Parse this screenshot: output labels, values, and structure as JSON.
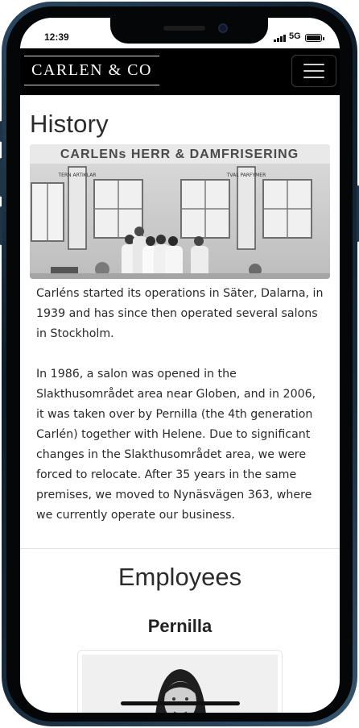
{
  "status_bar": {
    "time": "12:39",
    "network": "5G"
  },
  "navbar": {
    "brand": "CARLEN & CO"
  },
  "history": {
    "title": "History",
    "photo_sign": "CARLENs HERR & DAMFRISERING",
    "sign_left": "TERN ARTIKLAR",
    "sign_right": "TVAL PARFYMER",
    "paragraphs": [
      "Carléns started its operations in Säter, Dalarna, in 1939 and has since then operated several salons in Stockholm.",
      "In 1986, a salon was opened in the Slakthusområdet area near Globen, and in 2006, it was taken over by Pernilla (the 4th generation Carlén) together with Helene. Due to significant changes in the Slakthusområdet area, we were forced to relocate. After 35 years in the same premises, we moved to Nynäsvägen 363, where we currently operate our business."
    ]
  },
  "employees": {
    "title": "Employees",
    "items": [
      {
        "name": "Pernilla"
      }
    ]
  },
  "colors": {
    "navbar_bg": "#000000",
    "frame": "#1f3447",
    "text": "#2a2a2a"
  }
}
